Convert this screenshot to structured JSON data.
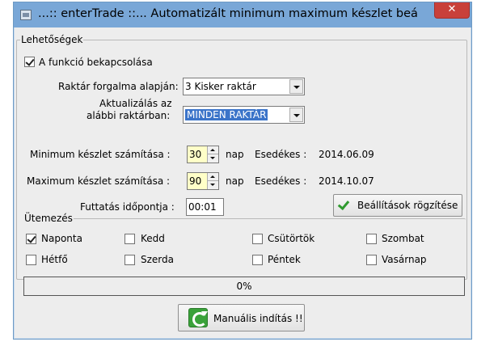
{
  "window": {
    "title": "...:: enterTrade ::... Automatizált minimum maximum készlet beállítá...",
    "close_label": "✕"
  },
  "options": {
    "group_label": "Lehetőségek",
    "enable_label": "A funkció bekapcsolása",
    "enable_checked": true,
    "warehouse_label": "Raktár forgalma alapján:",
    "warehouse_value": "3 Kisker raktár",
    "update_label_line1": "Aktualizálás az",
    "update_label_line2": "alábbi raktárban:",
    "update_value": "MINDEN RAKTÁR",
    "min_label": "Minimum készlet számítása :",
    "min_value": "30",
    "min_unit": "nap",
    "min_due_label": "Esedékes :",
    "min_due_date": "2014.06.09",
    "max_label": "Maximum készlet számítása :",
    "max_value": "90",
    "max_unit": "nap",
    "max_due_label": "Esedékes :",
    "max_due_date": "2014.10.07",
    "run_time_label": "Futtatás időpontja :",
    "run_time_value": "00:01",
    "save_button_label": "Beállítások rögzítése"
  },
  "schedule": {
    "group_label": "Ütemezés",
    "days": [
      {
        "label": "Naponta",
        "checked": true
      },
      {
        "label": "Kedd",
        "checked": false
      },
      {
        "label": "Csütörtök",
        "checked": false
      },
      {
        "label": "Szombat",
        "checked": false
      },
      {
        "label": "Hétfő",
        "checked": false
      },
      {
        "label": "Szerda",
        "checked": false
      },
      {
        "label": "Péntek",
        "checked": false
      },
      {
        "label": "Vasárnap",
        "checked": false
      }
    ]
  },
  "progress": {
    "value": 0,
    "text": "0%"
  },
  "manual_start_label": "Manuális indítás !!",
  "colors": {
    "titlebar": "#79a7d7",
    "close": "#c8403a",
    "selection": "#3b74c9",
    "spin_bg": "#ffffc8",
    "check_green": "#2f9a2f"
  }
}
